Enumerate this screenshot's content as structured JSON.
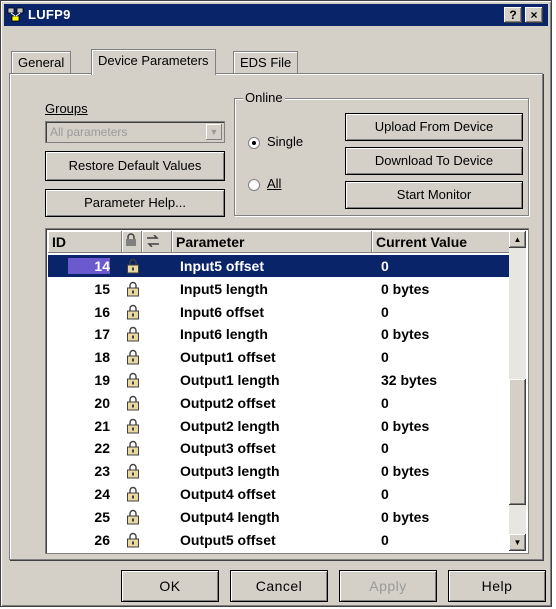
{
  "window": {
    "title": "LUFP9",
    "help_button": "?",
    "close_button": "×"
  },
  "tabs": [
    {
      "label": "General",
      "active": false
    },
    {
      "label": "Device Parameters",
      "active": true
    },
    {
      "label": "EDS File",
      "active": false
    }
  ],
  "groups": {
    "label": "Groups",
    "combo_value": "All parameters",
    "restore_button": "Restore Default Values",
    "help_button": "Parameter Help..."
  },
  "online": {
    "label": "Online",
    "options": [
      {
        "label": "Single",
        "checked": true
      },
      {
        "label": "All",
        "checked": false
      }
    ],
    "upload_button": "Upload From Device",
    "download_button": "Download To Device",
    "monitor_button": "Start Monitor"
  },
  "table": {
    "headers": [
      "ID",
      "Parameter",
      "Current Value"
    ],
    "rows": [
      {
        "id": "14",
        "param": "Input5 offset",
        "value": "0",
        "selected": true
      },
      {
        "id": "15",
        "param": "Input5 length",
        "value": "0 bytes"
      },
      {
        "id": "16",
        "param": "Input6 offset",
        "value": "0"
      },
      {
        "id": "17",
        "param": "Input6 length",
        "value": "0 bytes"
      },
      {
        "id": "18",
        "param": "Output1 offset",
        "value": "0"
      },
      {
        "id": "19",
        "param": "Output1 length",
        "value": "32 bytes"
      },
      {
        "id": "20",
        "param": "Output2 offset",
        "value": "0"
      },
      {
        "id": "21",
        "param": "Output2 length",
        "value": "0 bytes"
      },
      {
        "id": "22",
        "param": "Output3 offset",
        "value": "0"
      },
      {
        "id": "23",
        "param": "Output3 length",
        "value": "0 bytes"
      },
      {
        "id": "24",
        "param": "Output4 offset",
        "value": "0"
      },
      {
        "id": "25",
        "param": "Output4 length",
        "value": "0 bytes"
      },
      {
        "id": "26",
        "param": "Output5 offset",
        "value": "0"
      }
    ]
  },
  "footer": {
    "ok": "OK",
    "cancel": "Cancel",
    "apply": "Apply",
    "help": "Help"
  },
  "colors": {
    "title_bar": "#0a246a",
    "face": "#d4d0c8",
    "selection": "#0a246a"
  },
  "icons": {
    "app": "network-icon",
    "row": "lock-icon"
  }
}
